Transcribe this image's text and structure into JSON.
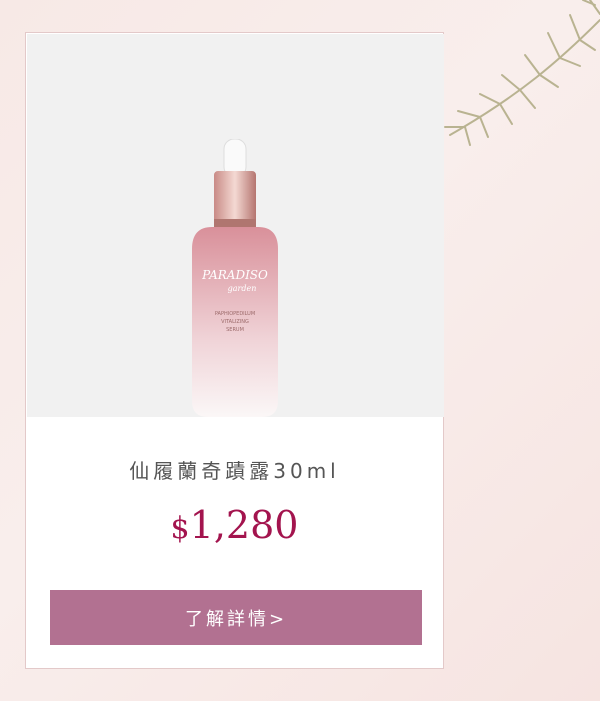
{
  "product": {
    "title": "仙履蘭奇蹟露30ml",
    "currency": "$",
    "price": "1,280",
    "cta_label": "了解詳情>",
    "bottle_brand": "PARADISO",
    "bottle_sub": "garden",
    "bottle_desc1": "PAPHIOPEDILUM",
    "bottle_desc2": "VITALIZING",
    "bottle_desc3": "SERUM"
  },
  "colors": {
    "accent": "#a3144e",
    "button": "#b27191",
    "background": "#f7e9e6"
  }
}
